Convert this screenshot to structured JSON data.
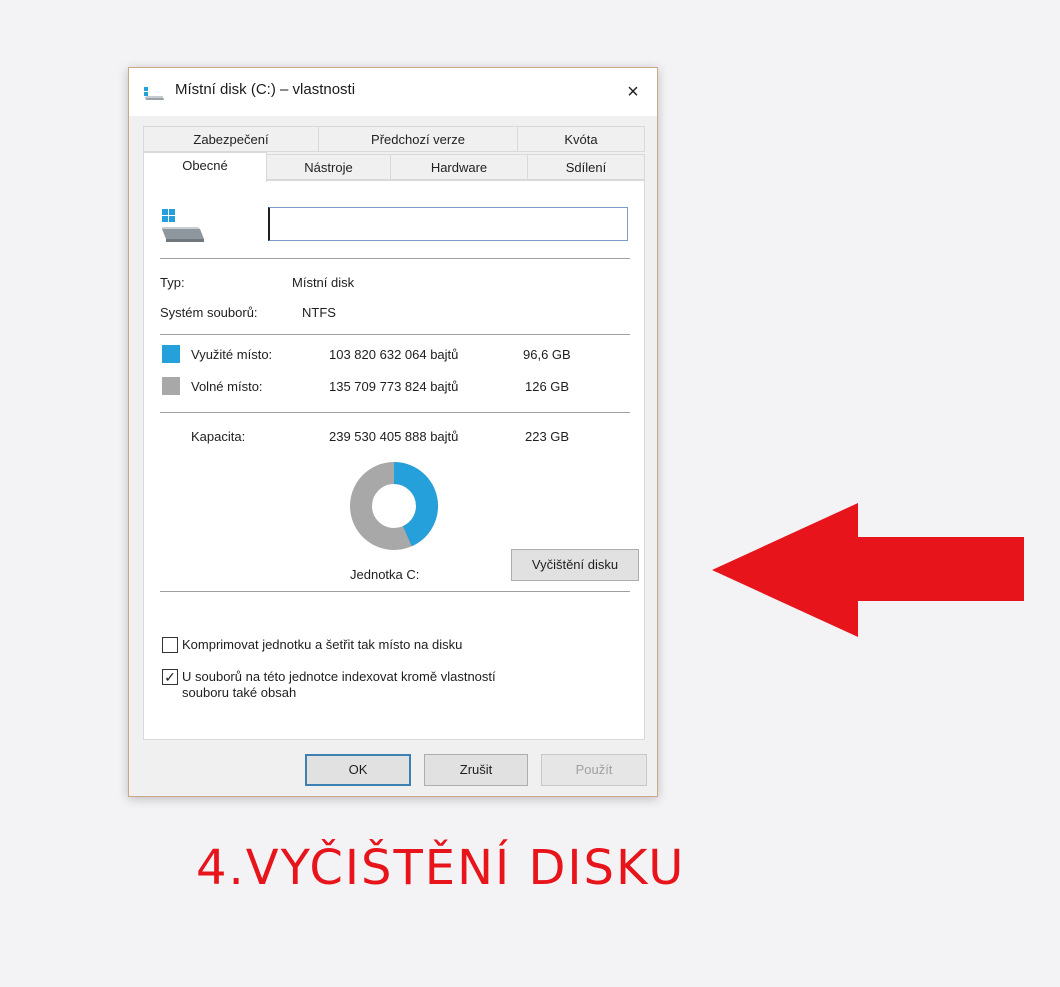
{
  "dialog": {
    "title": "Místní disk (C:) – vlastnosti",
    "close_icon": "×",
    "tabs_back": [
      "Zabezpečení",
      "Předchozí verze",
      "Kvóta"
    ],
    "tabs_front": [
      "Obecné",
      "Nástroje",
      "Hardware",
      "Sdílení"
    ],
    "active_tab": "Obecné",
    "name_value": "",
    "type_label": "Typ:",
    "type_value": "Místní disk",
    "fs_label": "Systém souborů:",
    "fs_value": "NTFS",
    "used_label": "Využité místo:",
    "used_bytes": "103 820 632 064 bajtů",
    "used_size": "96,6 GB",
    "free_label": "Volné místo:",
    "free_bytes": "135 709 773 824 bajtů",
    "free_size": "126 GB",
    "capacity_label": "Kapacita:",
    "capacity_bytes": "239 530 405 888 bajtů",
    "capacity_size": "223 GB",
    "used_fraction": 0.433,
    "drive_label": "Jednotka C:",
    "cleanup_button": "Vyčištění disku",
    "compress_label": "Komprimovat jednotku a šetřit tak místo na disku",
    "compress_checked": false,
    "index_label_line1": "U souborů na této jednotce indexovat kromě vlastností",
    "index_label_line2": "souboru také obsah",
    "index_checked": true,
    "ok_button": "OK",
    "cancel_button": "Zrušit",
    "apply_button": "Použít"
  },
  "colors": {
    "used": "#26a0da",
    "free": "#a8a8a8",
    "accent_red": "#e8141b"
  },
  "icons": {
    "title": "drive-icon",
    "drive": "windows-drive-icon",
    "annotation": "red-arrow-left-icon"
  },
  "caption": "4.VYČIŠTĚNÍ DISKU"
}
